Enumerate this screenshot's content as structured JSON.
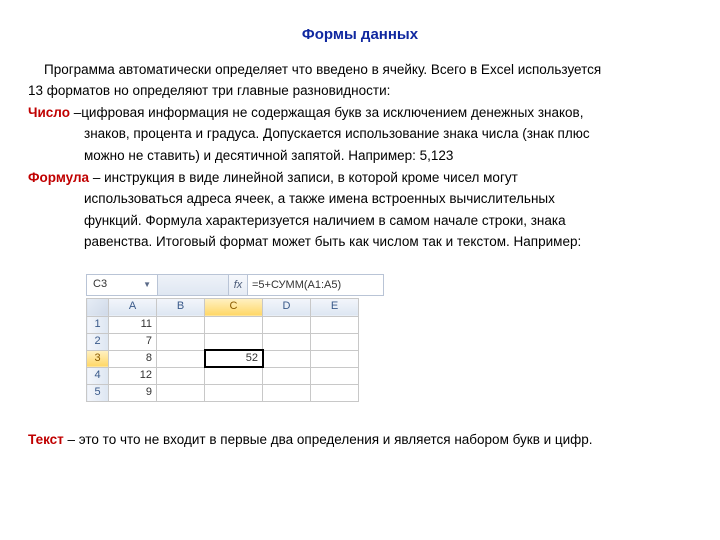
{
  "title": "Формы данных",
  "intro1": "Программа автоматически определяет что введено в ячейку. Всего в Excel используется",
  "intro2": "13 форматов но определяют три главные разновидности:",
  "number_term": "Число",
  "number_l1": " –цифровая информация не содержащая букв за исключением денежных знаков,",
  "number_l2": "знаков, процента и градуса. Допускается использование знака числа (знак плюс",
  "number_l3": "можно не ставить) и десятичной запятой. Например: 5,123",
  "formula_term": "Формула",
  "formula_l1": " – инструкция в виде линейной записи, в которой кроме чисел могут",
  "formula_l2": "использоваться адреса ячеек, а также имена встроенных вычислительных",
  "formula_l3": "функций. Формула характеризуется наличием в самом начале строки, знака",
  "formula_l4": "равенства. Итоговый формат может быть как числом так и текстом. Например:",
  "text_term": "Текст",
  "text_l1": " – это то что не входит в первые два определения и является набором букв и цифр.",
  "excel": {
    "namebox": "C3",
    "fx": "fx",
    "formula": "=5+СУММ(A1:A5)",
    "cols": {
      "A": "A",
      "B": "B",
      "C": "C",
      "D": "D",
      "E": "E"
    },
    "rows": {
      "r1": {
        "h": "1",
        "A": "11"
      },
      "r2": {
        "h": "2",
        "A": "7"
      },
      "r3": {
        "h": "3",
        "A": "8",
        "C": "52"
      },
      "r4": {
        "h": "4",
        "A": "12"
      },
      "r5": {
        "h": "5",
        "A": "9"
      }
    }
  }
}
